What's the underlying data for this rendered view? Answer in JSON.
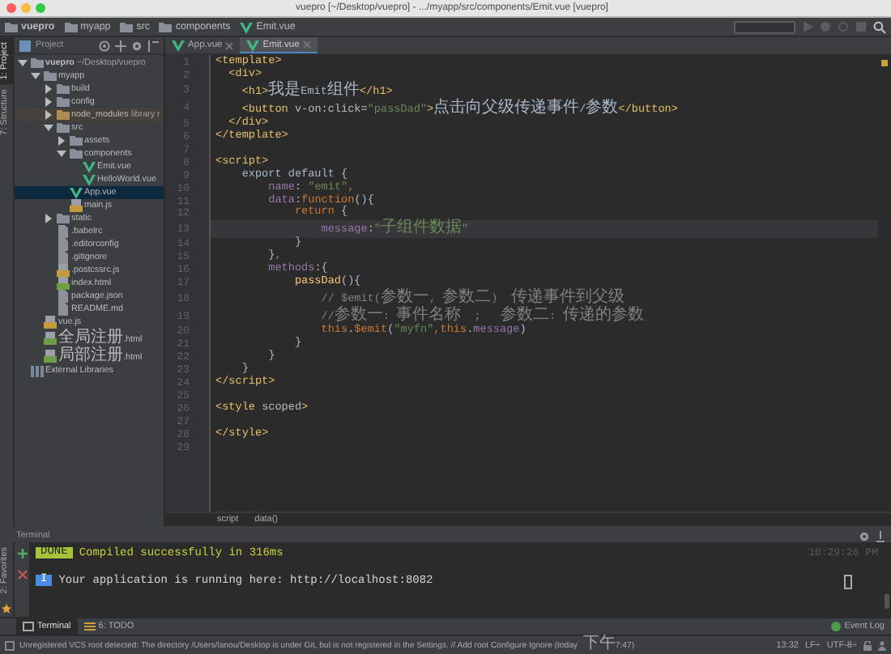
{
  "window": {
    "title": "vuepro [~/Desktop/vuepro] - .../myapp/src/components/Emit.vue [vuepro]"
  },
  "navbar": {
    "crumbs": [
      {
        "label": "vuepro",
        "kind": "folder"
      },
      {
        "label": "myapp",
        "kind": "folder"
      },
      {
        "label": "src",
        "kind": "folder"
      },
      {
        "label": "components",
        "kind": "folder"
      },
      {
        "label": "Emit.vue",
        "kind": "vue"
      }
    ]
  },
  "left_strip": {
    "tabs": [
      {
        "label": "1: Project",
        "selected": true
      },
      {
        "label": "7: Structure",
        "selected": false
      }
    ]
  },
  "project_panel": {
    "title": "Project",
    "tree": [
      {
        "label": "vuepro",
        "hint": "~/Desktop/vuepro",
        "kind": "folder",
        "expanded": true,
        "selected": false,
        "children": [
          {
            "label": "myapp",
            "kind": "folder",
            "expanded": true,
            "selected": false,
            "children": [
              {
                "label": "build",
                "kind": "folder",
                "expanded": false,
                "selected": false
              },
              {
                "label": "config",
                "kind": "folder",
                "expanded": false,
                "selected": false
              },
              {
                "label": "node_modules",
                "hint": "library r",
                "kind": "excluded",
                "expanded": false,
                "selected": false
              },
              {
                "label": "src",
                "kind": "folder",
                "expanded": true,
                "selected": false,
                "children": [
                  {
                    "label": "assets",
                    "kind": "folder",
                    "expanded": false,
                    "selected": false
                  },
                  {
                    "label": "components",
                    "kind": "folder",
                    "expanded": true,
                    "selected": false,
                    "children": [
                      {
                        "label": "Emit.vue",
                        "kind": "vue",
                        "selected": false
                      },
                      {
                        "label": "HelloWorld.vue",
                        "kind": "vue",
                        "selected": false
                      }
                    ]
                  },
                  {
                    "label": "App.vue",
                    "kind": "vue",
                    "selected": true
                  },
                  {
                    "label": "main.js",
                    "kind": "js",
                    "selected": false
                  }
                ]
              },
              {
                "label": "static",
                "kind": "folder",
                "expanded": false,
                "selected": false
              },
              {
                "label": ".babelrc",
                "kind": "file",
                "selected": false
              },
              {
                "label": ".editorconfig",
                "kind": "file",
                "selected": false
              },
              {
                "label": ".gitignore",
                "kind": "file",
                "selected": false
              },
              {
                "label": ".postcssrc.js",
                "kind": "js",
                "selected": false
              },
              {
                "label": "index.html",
                "kind": "html",
                "selected": false
              },
              {
                "label": "package.json",
                "kind": "file",
                "selected": false
              },
              {
                "label": "README.md",
                "kind": "file",
                "selected": false
              }
            ]
          },
          {
            "label": "vue.js",
            "kind": "js",
            "selected": false
          },
          {
            "label": "全局注册.html",
            "kind": "html",
            "selected": false
          },
          {
            "label": "局部注册.html",
            "kind": "html",
            "selected": false
          }
        ]
      },
      {
        "label": "External Libraries",
        "kind": "library",
        "selected": false
      }
    ]
  },
  "editor": {
    "tabs": [
      {
        "label": "App.vue",
        "selected": false
      },
      {
        "label": "Emit.vue",
        "selected": true
      }
    ],
    "lines": [
      {
        "number": "1",
        "current": false,
        "tokens": [
          {
            "kind": "tag",
            "text": "<template>"
          }
        ]
      },
      {
        "number": "2",
        "current": false,
        "tokens": [
          {
            "kind": "tag",
            "text": "  <div>"
          }
        ]
      },
      {
        "number": "3",
        "current": false,
        "tokens": [
          {
            "kind": "tag",
            "text": "    <h1>"
          },
          {
            "kind": "plain",
            "text": "我是Emit组件"
          },
          {
            "kind": "tag",
            "text": "</h1>"
          }
        ]
      },
      {
        "number": "4",
        "current": false,
        "tokens": [
          {
            "kind": "tag",
            "text": "    <button "
          },
          {
            "kind": "attr",
            "text": "v-on:click="
          },
          {
            "kind": "str",
            "text": "\"passDad\""
          },
          {
            "kind": "tag",
            "text": ">"
          },
          {
            "kind": "plain",
            "text": "点击向父级传递事件/参数"
          },
          {
            "kind": "tag",
            "text": "</button>"
          }
        ]
      },
      {
        "number": "5",
        "current": false,
        "tokens": [
          {
            "kind": "tag",
            "text": "  </div>"
          }
        ]
      },
      {
        "number": "6",
        "current": false,
        "tokens": [
          {
            "kind": "tag",
            "text": "</template>"
          }
        ]
      },
      {
        "number": "7",
        "current": false
      },
      {
        "number": "8",
        "current": false,
        "tokens": [
          {
            "kind": "tag",
            "text": "<script>"
          }
        ]
      },
      {
        "number": "9",
        "current": false,
        "tokens": [
          {
            "kind": "plain",
            "text": "    export default {"
          }
        ]
      },
      {
        "number": "10",
        "current": false,
        "tokens": [
          {
            "kind": "prop",
            "text": "        name"
          },
          {
            "kind": "plain",
            "text": ": "
          },
          {
            "kind": "str",
            "text": "\"emit\""
          },
          {
            "kind": "kw",
            "text": ","
          }
        ]
      },
      {
        "number": "11",
        "current": false,
        "tokens": [
          {
            "kind": "prop",
            "text": "        data"
          },
          {
            "kind": "plain",
            "text": ":"
          },
          {
            "kind": "kw",
            "text": "function"
          },
          {
            "kind": "plain",
            "text": "(){"
          }
        ]
      },
      {
        "number": "12",
        "current": false,
        "tokens": [
          {
            "kind": "kw",
            "text": "            return "
          },
          {
            "kind": "plain",
            "text": "{"
          }
        ]
      },
      {
        "number": "13",
        "current": true,
        "tokens": [
          {
            "kind": "prop",
            "text": "                message"
          },
          {
            "kind": "plain",
            "text": ":"
          },
          {
            "kind": "str",
            "text": "\"子组件数据\""
          }
        ]
      },
      {
        "number": "14",
        "current": false,
        "tokens": [
          {
            "kind": "plain",
            "text": "            }"
          }
        ]
      },
      {
        "number": "15",
        "current": false,
        "tokens": [
          {
            "kind": "plain",
            "text": "        }"
          },
          {
            "kind": "kw",
            "text": ","
          }
        ]
      },
      {
        "number": "16",
        "current": false,
        "tokens": [
          {
            "kind": "prop",
            "text": "        methods"
          },
          {
            "kind": "plain",
            "text": ":{"
          }
        ]
      },
      {
        "number": "17",
        "current": false,
        "tokens": [
          {
            "kind": "fn",
            "text": "            passDad"
          },
          {
            "kind": "plain",
            "text": "(){"
          }
        ]
      },
      {
        "number": "18",
        "current": false,
        "tokens": [
          {
            "kind": "comment",
            "text": "                // $emit(参数一, 参数二)  传递事件到父级"
          }
        ]
      },
      {
        "number": "19",
        "current": false,
        "tokens": [
          {
            "kind": "comment",
            "text": "                //参数一: 事件名称  ;   参数二: 传递的参数"
          }
        ]
      },
      {
        "number": "20",
        "current": false,
        "tokens": [
          {
            "kind": "kw",
            "text": "                this"
          },
          {
            "kind": "plain",
            "text": "."
          },
          {
            "kind": "kw",
            "text": "$emit"
          },
          {
            "kind": "plain",
            "text": "("
          },
          {
            "kind": "str",
            "text": "\"myfn\""
          },
          {
            "kind": "kw",
            "text": ",this"
          },
          {
            "kind": "plain",
            "text": "."
          },
          {
            "kind": "prop",
            "text": "message"
          },
          {
            "kind": "plain",
            "text": ")"
          }
        ]
      },
      {
        "number": "21",
        "current": false,
        "tokens": [
          {
            "kind": "plain",
            "text": "            }"
          }
        ]
      },
      {
        "number": "22",
        "current": false,
        "tokens": [
          {
            "kind": "plain",
            "text": "        }"
          }
        ]
      },
      {
        "number": "23",
        "current": false,
        "tokens": [
          {
            "kind": "plain",
            "text": "    }"
          }
        ]
      },
      {
        "number": "24",
        "current": false,
        "tokens": [
          {
            "kind": "tag",
            "text": "</script>"
          }
        ]
      },
      {
        "number": "25",
        "current": false
      },
      {
        "number": "26",
        "current": false,
        "tokens": [
          {
            "kind": "tag",
            "text": "<style "
          },
          {
            "kind": "attr",
            "text": "scoped"
          },
          {
            "kind": "tag",
            "text": ">"
          }
        ]
      },
      {
        "number": "27",
        "current": false
      },
      {
        "number": "28",
        "current": false,
        "tokens": [
          {
            "kind": "tag",
            "text": "</style>"
          }
        ]
      },
      {
        "number": "29",
        "current": false
      }
    ],
    "breadcrumbs": [
      "script",
      "data()"
    ]
  },
  "terminal": {
    "title": "Terminal",
    "favorites": "2: Favorites",
    "lines": [
      {
        "kind": "done",
        "badge": "DONE",
        "text": "Compiled successfully in 316ms",
        "time": "10:29:26 PM"
      },
      {
        "kind": "info",
        "badge": "I",
        "text": "Your application is running here: http://localhost:8082"
      }
    ]
  },
  "bottom_tabs": [
    {
      "label": "Terminal",
      "selected": true
    },
    {
      "label": "6: TODO",
      "selected": false
    }
  ],
  "event_log": "Event Log",
  "status_bar": {
    "message": "Unregistered VCS root detected: The directory /Users/lanou/Desktop is under Git, but is not registered in the Settings. // Add root  Configure  Ignore (today 下午7:47)",
    "position": "13:32",
    "line_sep": "LF÷",
    "encoding": "UTF-8÷"
  }
}
